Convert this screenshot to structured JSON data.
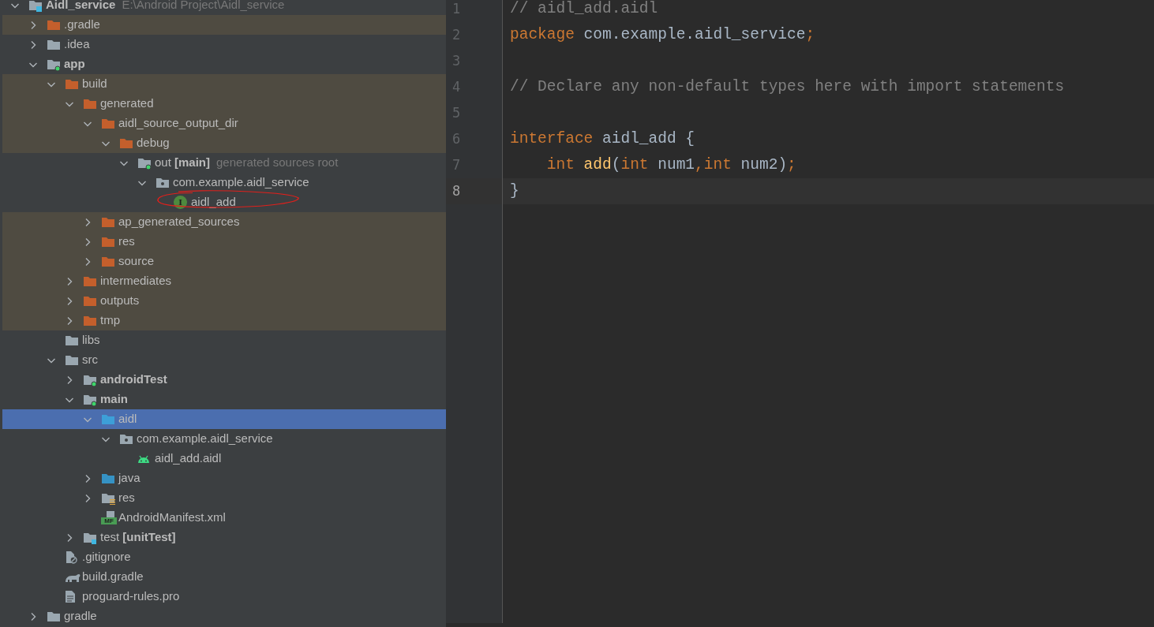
{
  "project_tree": [
    {
      "label": "Aidl_service",
      "bold": true,
      "detail": "E:\\Android Project\\Aidl_service",
      "kind": "module",
      "expanded": true,
      "excluded": false,
      "selected": false,
      "children": [
        {
          "label": ".gradle",
          "kind": "excluded-folder",
          "expanded": false,
          "excluded": true,
          "selected": false
        },
        {
          "label": ".idea",
          "kind": "folder",
          "expanded": false,
          "excluded": false,
          "selected": false
        },
        {
          "label": "app",
          "bold": true,
          "kind": "module-folder",
          "expanded": true,
          "excluded": false,
          "selected": false,
          "children": [
            {
              "label": "build",
              "kind": "excluded-folder",
              "expanded": true,
              "excluded": true,
              "selected": false,
              "children": [
                {
                  "label": "generated",
                  "kind": "excluded-folder",
                  "expanded": true,
                  "excluded": true,
                  "selected": false,
                  "children": [
                    {
                      "label": "aidl_source_output_dir",
                      "kind": "excluded-folder",
                      "expanded": true,
                      "excluded": true,
                      "selected": false,
                      "children": [
                        {
                          "label": "debug",
                          "kind": "excluded-folder",
                          "expanded": true,
                          "excluded": true,
                          "selected": false,
                          "children": [
                            {
                              "label": "out **[main]**",
                              "detail": "generated sources root",
                              "kind": "module-folder",
                              "expanded": true,
                              "excluded": false,
                              "selected": false,
                              "children": [
                                {
                                  "label": "com.example.aidl_service",
                                  "kind": "package",
                                  "expanded": true,
                                  "excluded": false,
                                  "selected": false,
                                  "children": [
                                    {
                                      "label": "aidl_add",
                                      "kind": "interface",
                                      "icon_text": "I",
                                      "annotated": true,
                                      "excluded": false,
                                      "selected": false
                                    }
                                  ]
                                }
                              ]
                            }
                          ]
                        }
                      ]
                    },
                    {
                      "label": "ap_generated_sources",
                      "kind": "excluded-folder",
                      "expanded": false,
                      "excluded": true,
                      "selected": false
                    },
                    {
                      "label": "res",
                      "kind": "excluded-folder",
                      "expanded": false,
                      "excluded": true,
                      "selected": false
                    },
                    {
                      "label": "source",
                      "kind": "excluded-folder",
                      "expanded": false,
                      "excluded": true,
                      "selected": false
                    }
                  ]
                },
                {
                  "label": "intermediates",
                  "kind": "excluded-folder",
                  "expanded": false,
                  "excluded": true,
                  "selected": false
                },
                {
                  "label": "outputs",
                  "kind": "excluded-folder",
                  "expanded": false,
                  "excluded": true,
                  "selected": false
                },
                {
                  "label": "tmp",
                  "kind": "excluded-folder",
                  "expanded": false,
                  "excluded": true,
                  "selected": false
                }
              ]
            },
            {
              "label": "libs",
              "kind": "folder",
              "excluded": false,
              "selected": false
            },
            {
              "label": "src",
              "kind": "folder",
              "expanded": true,
              "excluded": false,
              "selected": false,
              "children": [
                {
                  "label": "androidTest",
                  "bold": true,
                  "kind": "module-folder",
                  "expanded": false,
                  "excluded": false,
                  "selected": false
                },
                {
                  "label": "main",
                  "bold": true,
                  "kind": "module-folder",
                  "expanded": true,
                  "excluded": false,
                  "selected": false,
                  "children": [
                    {
                      "label": "aidl",
                      "kind": "source-folder",
                      "expanded": true,
                      "selected": true,
                      "children": [
                        {
                          "label": "com.example.aidl_service",
                          "kind": "package",
                          "expanded": true,
                          "excluded": false,
                          "selected": false,
                          "children": [
                            {
                              "label": "aidl_add.aidl",
                              "kind": "android-file",
                              "excluded": false,
                              "selected": false
                            }
                          ]
                        }
                      ]
                    },
                    {
                      "label": "java",
                      "kind": "java-folder",
                      "expanded": false,
                      "excluded": false,
                      "selected": false
                    },
                    {
                      "label": "res",
                      "kind": "resource-folder",
                      "expanded": false,
                      "excluded": false,
                      "selected": false
                    },
                    {
                      "label": "AndroidManifest.xml",
                      "kind": "manifest",
                      "icon_text": "MF",
                      "excluded": false,
                      "selected": false
                    }
                  ]
                },
                {
                  "label": "test **[unitTest]**",
                  "kind": "test-folder",
                  "expanded": false,
                  "excluded": false,
                  "selected": false
                }
              ]
            },
            {
              "label": ".gitignore",
              "kind": "ignored-file",
              "excluded": false,
              "selected": false
            },
            {
              "label": "build.gradle",
              "kind": "gradle-file",
              "excluded": false,
              "selected": false
            },
            {
              "label": "proguard-rules.pro",
              "kind": "text-file",
              "excluded": false,
              "selected": false
            }
          ]
        },
        {
          "label": "gradle",
          "kind": "folder",
          "expanded": false,
          "excluded": false,
          "selected": false
        }
      ]
    }
  ],
  "editor": {
    "lines": [
      {
        "number": "1",
        "current": false,
        "tokens": [
          {
            "text": "// aidl_add.aidl",
            "kind": "comment"
          }
        ]
      },
      {
        "number": "2",
        "current": false,
        "tokens": [
          {
            "text": "package",
            "kind": "keyword"
          },
          {
            "text": " com.example.aidl_service",
            "kind": "plain"
          },
          {
            "text": ";",
            "kind": "keyword"
          }
        ]
      },
      {
        "number": "3",
        "current": false
      },
      {
        "number": "4",
        "current": false,
        "tokens": [
          {
            "text": "// Declare any non-default types here with import statements",
            "kind": "comment"
          }
        ]
      },
      {
        "number": "5",
        "current": false
      },
      {
        "number": "6",
        "current": false,
        "tokens": [
          {
            "text": "interface",
            "kind": "keyword"
          },
          {
            "text": " aidl_add {",
            "kind": "plain"
          }
        ]
      },
      {
        "number": "7",
        "current": false,
        "tokens": [
          {
            "text": "    int",
            "kind": "keyword"
          },
          {
            "text": " add",
            "kind": "method"
          },
          {
            "text": "(",
            "kind": "plain"
          },
          {
            "text": "int",
            "kind": "keyword"
          },
          {
            "text": " num1",
            "kind": "plain"
          },
          {
            "text": ",int",
            "kind": "keyword"
          },
          {
            "text": " num2)",
            "kind": "plain"
          },
          {
            "text": ";",
            "kind": "keyword"
          }
        ]
      },
      {
        "number": "8",
        "current": true,
        "tokens": [
          {
            "text": "}",
            "kind": "plain"
          }
        ]
      }
    ]
  }
}
